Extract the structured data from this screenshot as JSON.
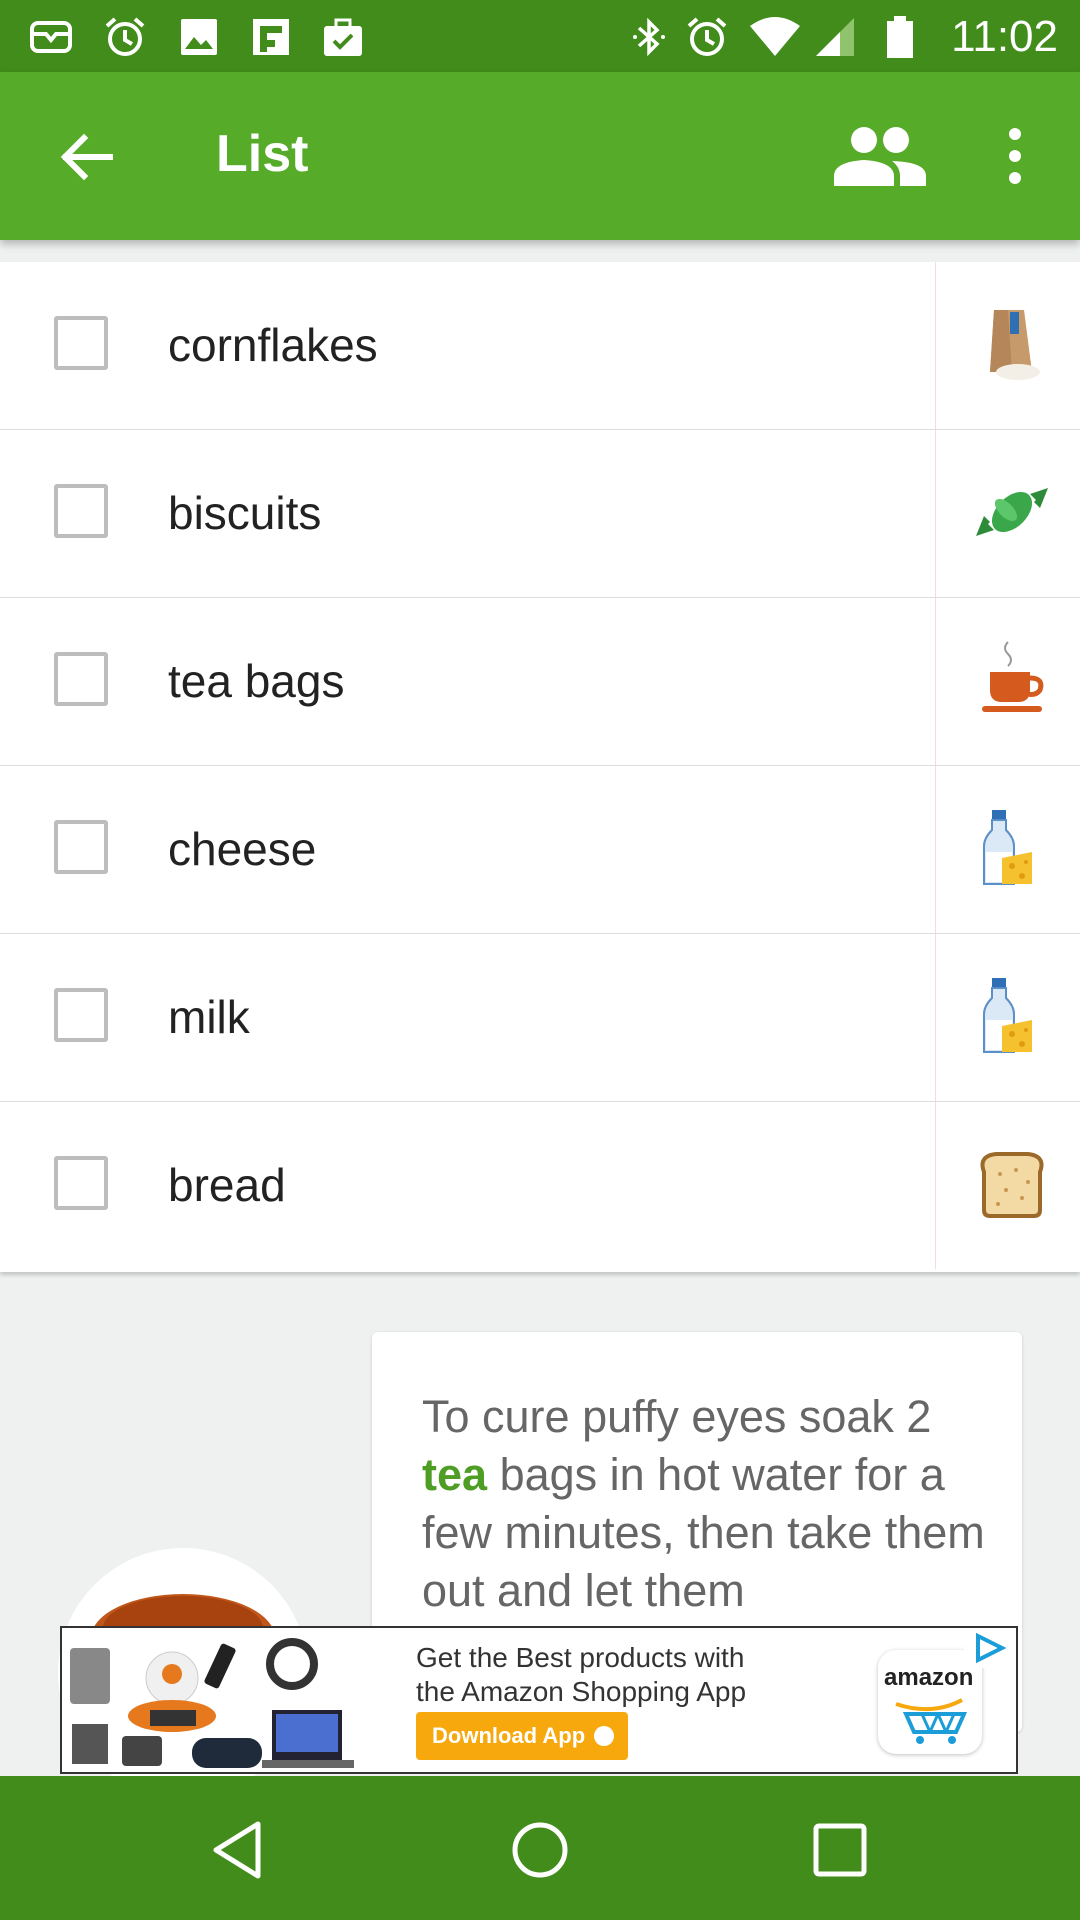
{
  "status_bar": {
    "time": "11:02",
    "left_icons": [
      "mail-icon",
      "alarm-icon",
      "image-icon",
      "flipboard-icon",
      "briefcase-check-icon"
    ],
    "right_icons": [
      "bluetooth-icon",
      "alarm-icon",
      "wifi-icon",
      "signal-icon",
      "battery-icon"
    ]
  },
  "app_bar": {
    "title": "List",
    "back_icon": "arrow-back-icon",
    "share_icon": "people-icon",
    "more_icon": "more-vertical-icon"
  },
  "list": {
    "items": [
      {
        "label": "cornflakes",
        "checked": false,
        "icon": "cereal-bag-icon"
      },
      {
        "label": "biscuits",
        "checked": false,
        "icon": "candy-icon"
      },
      {
        "label": "tea bags",
        "checked": false,
        "icon": "tea-cup-icon"
      },
      {
        "label": "cheese",
        "checked": false,
        "icon": "milk-cheese-icon"
      },
      {
        "label": "milk",
        "checked": false,
        "icon": "milk-cheese-icon"
      },
      {
        "label": "bread",
        "checked": false,
        "icon": "bread-icon"
      }
    ]
  },
  "tip": {
    "text_before": "To cure puffy eyes soak 2",
    "highlight": "tea",
    "text_after": "bags in hot water for a few minutes, then take them out and let them"
  },
  "ad": {
    "line1": "Get the Best products with",
    "line2": "the Amazon Shopping App",
    "button": "Download App",
    "brand": "amazon"
  },
  "colors": {
    "status_bar": "#418c1a",
    "app_bar": "#56ab29",
    "accent_text": "#4e9d24",
    "nav_bar": "#418c1a"
  }
}
